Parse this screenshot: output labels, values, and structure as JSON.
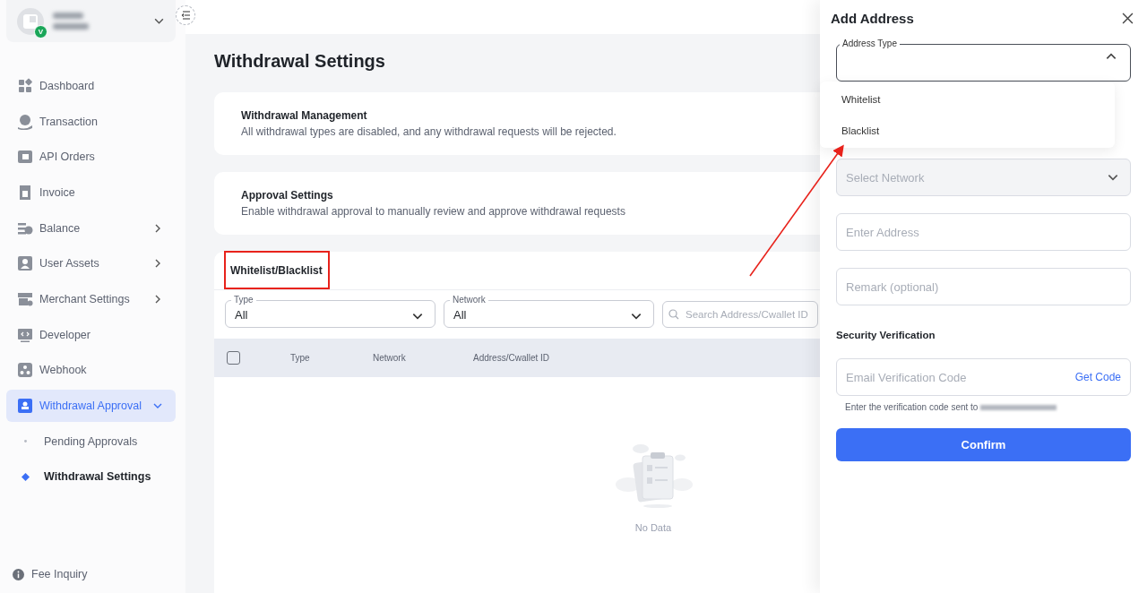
{
  "sidebar": {
    "account": {
      "badge": "V"
    },
    "items": [
      {
        "label": "Dashboard",
        "kind": "link",
        "selected": false
      },
      {
        "label": "Transaction",
        "kind": "link",
        "selected": false
      },
      {
        "label": "API Orders",
        "kind": "link",
        "selected": false
      },
      {
        "label": "Invoice",
        "kind": "link",
        "selected": false
      },
      {
        "label": "Balance",
        "kind": "group",
        "expanded": false,
        "selected": false
      },
      {
        "label": "User Assets",
        "kind": "group",
        "expanded": false,
        "selected": false
      },
      {
        "label": "Merchant Settings",
        "kind": "group",
        "expanded": false,
        "selected": false
      },
      {
        "label": "Developer",
        "kind": "link",
        "selected": false
      },
      {
        "label": "Webhook",
        "kind": "link",
        "selected": false
      },
      {
        "label": "Withdrawal Approval",
        "kind": "group",
        "expanded": true,
        "selected": true,
        "children": [
          {
            "label": "Pending Approvals",
            "selected": false
          },
          {
            "label": "Withdrawal Settings",
            "selected": true
          }
        ]
      }
    ],
    "footer": "Fee Inquiry"
  },
  "page": {
    "title": "Withdrawal Settings",
    "cards": [
      {
        "title": "Withdrawal Management",
        "description": "All withdrawal types are disabled, and any withdrawal requests will be rejected."
      },
      {
        "title": "Approval Settings",
        "description": "Enable withdrawal approval to manually review and approve withdrawal requests"
      }
    ],
    "list_section": {
      "tab": "Whitelist/Blacklist",
      "filters": [
        {
          "label": "Type",
          "value": "All"
        },
        {
          "label": "Network",
          "value": "All"
        }
      ],
      "search": {
        "placeholder": "Search Address/Cwallet ID"
      },
      "table": {
        "select_all_checked": false,
        "columns": [
          "Type",
          "Network",
          "Address/Cwallet ID"
        ],
        "empty_text": "No Data"
      }
    }
  },
  "drawer": {
    "title": "Add Address",
    "address_type": {
      "label": "Address Type",
      "expanded": true,
      "options": [
        {
          "label": "Whitelist",
          "selected": false
        },
        {
          "label": "Blacklist",
          "selected": false
        }
      ]
    },
    "fields": [
      {
        "kind": "select",
        "placeholder": "Select Network",
        "disabled": true
      },
      {
        "kind": "input",
        "placeholder": "Enter Address",
        "disabled": false
      },
      {
        "kind": "input",
        "placeholder": "Remark (optional)",
        "disabled": false
      }
    ],
    "security": {
      "heading": "Security Verification",
      "placeholder": "Email Verification Code",
      "action": "Get Code",
      "hint": "Enter the verification code sent to"
    },
    "confirm": "Confirm"
  },
  "annotations": {
    "highlight_box": true,
    "arrow": true
  }
}
